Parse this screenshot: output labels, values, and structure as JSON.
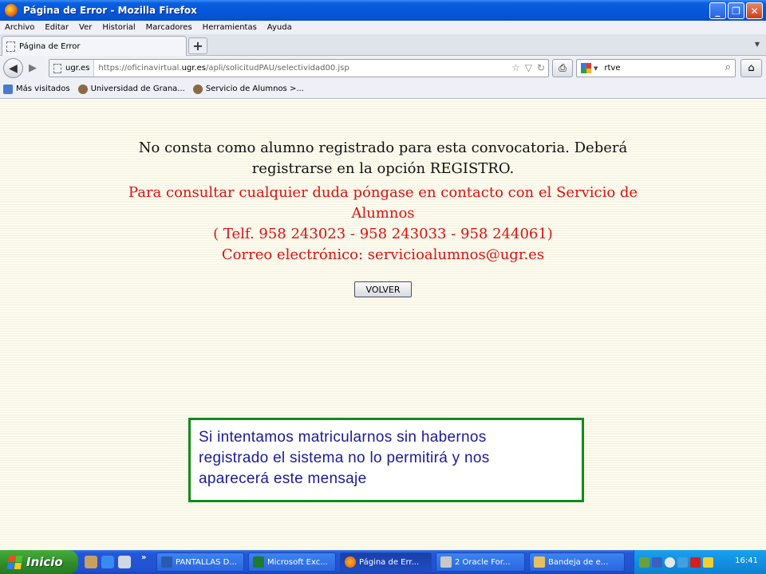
{
  "window": {
    "title": "Página de Error - Mozilla Firefox",
    "buttons": {
      "minimize": "_",
      "maximize": "❐",
      "close": "✕"
    }
  },
  "menu": [
    "Archivo",
    "Editar",
    "Ver",
    "Historial",
    "Marcadores",
    "Herramientas",
    "Ayuda"
  ],
  "tabs": [
    {
      "label": "Página de Error"
    }
  ],
  "newtab_label": "+",
  "nav": {
    "site_identity": "ugr.es",
    "url_prefix": "https://oficinavirtual.",
    "url_domain": "ugr.es",
    "url_path": "/apli/solicitudPAU/selectividad00.jsp",
    "search_value": "rtve"
  },
  "bookmarks": [
    {
      "label": "Más visitados",
      "icon": "most-visited-icon"
    },
    {
      "label": "Universidad de Grana...",
      "icon": "ugr-seal-icon"
    },
    {
      "label": "Servicio de Alumnos >...",
      "icon": "ugr-seal-icon"
    }
  ],
  "content": {
    "message_line1": "No consta como alumno registrado para esta convocatoria. Deberá",
    "message_line2": "registrarse en la opción REGISTRO.",
    "contact_line1": "Para consultar cualquier duda póngase en contacto con el Servicio de",
    "contact_line2": "Alumnos",
    "contact_line3": "( Telf. 958 243023 - 958 243033 - 958 244061)",
    "contact_line4": "Correo electrónico: servicioalumnos@ugr.es",
    "button_label": "VOLVER"
  },
  "annotation": {
    "line1": "Si intentamos matricularnos sin habernos",
    "line2": "registrado el sistema no lo permitirá y nos",
    "line3": "aparecerá este mensaje"
  },
  "taskbar": {
    "start_label": "Inicio",
    "more_label": "»",
    "tasks": [
      {
        "label": "PANTALLAS D...",
        "icon": "word-icon"
      },
      {
        "label": "Microsoft Exc...",
        "icon": "excel-icon"
      },
      {
        "label": "Página de Err...",
        "icon": "firefox-icon"
      },
      {
        "label": "2 Oracle For...",
        "icon": "oracle-icon"
      },
      {
        "label": "Bandeja de e...",
        "icon": "mail-icon"
      }
    ],
    "clock": "16:41"
  },
  "colors": {
    "error_red": "#e01010",
    "note_border": "#118c1a",
    "note_text": "#1a1a9a",
    "content_bg": "#fcfbed"
  }
}
